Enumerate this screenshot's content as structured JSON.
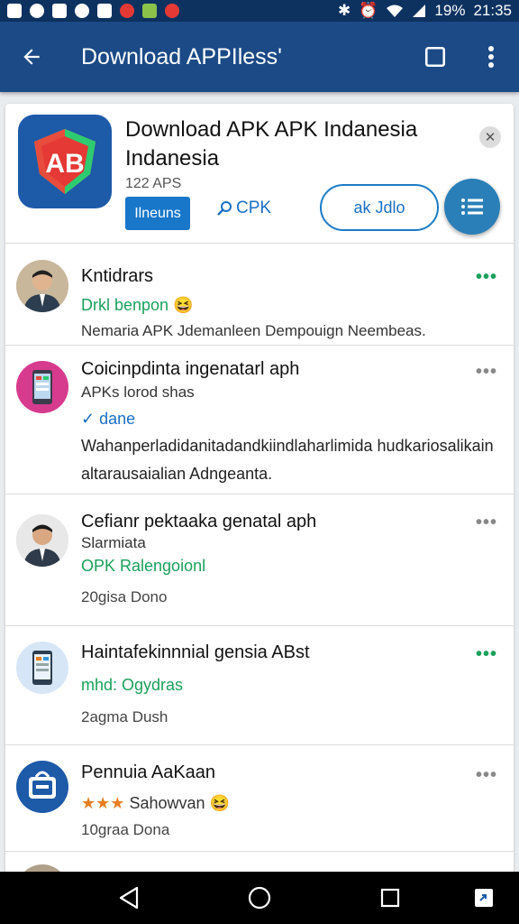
{
  "status_bar": {
    "battery": "19%",
    "time": "21:35"
  },
  "app_bar": {
    "title": "Download APPIless'"
  },
  "header": {
    "title": "Download APK APK Indanesia Indanesia",
    "meta": "122 APS",
    "tag": "Ilneuns",
    "apk_link": "CPK",
    "pill_label": "ak Jdlo",
    "logo_text": "AB"
  },
  "items": [
    {
      "title": "Kntidrars",
      "status": "Drkl benpon",
      "desc": "Nemaria APK Jdemanleen Dempouign Neembeas."
    },
    {
      "title": "Coicinpdinta ingenatarl aph",
      "subtitle": "APKs lorod shas",
      "status": "dane",
      "desc": "Wahanperladidanitadandkiindlaharlimida hudkariosalikain altarausaialian Adngeanta."
    },
    {
      "title": "Cefianr pektaaka genatal aph",
      "subtitle": "Slarmiata",
      "status": "OPK Ralengoionl",
      "time": "20gisa Dono"
    },
    {
      "title": "Haintafekinnnial gensia ABst",
      "status": "mhd: Ogydras",
      "time": "2agma Dush"
    },
    {
      "title": "Pennuia AaKaan",
      "status": "Sahowvan",
      "time": "10graa Dona"
    }
  ],
  "colors": {
    "appbar": "#1b4a86",
    "accent": "#1a6fc4",
    "green": "#1aa05a"
  }
}
